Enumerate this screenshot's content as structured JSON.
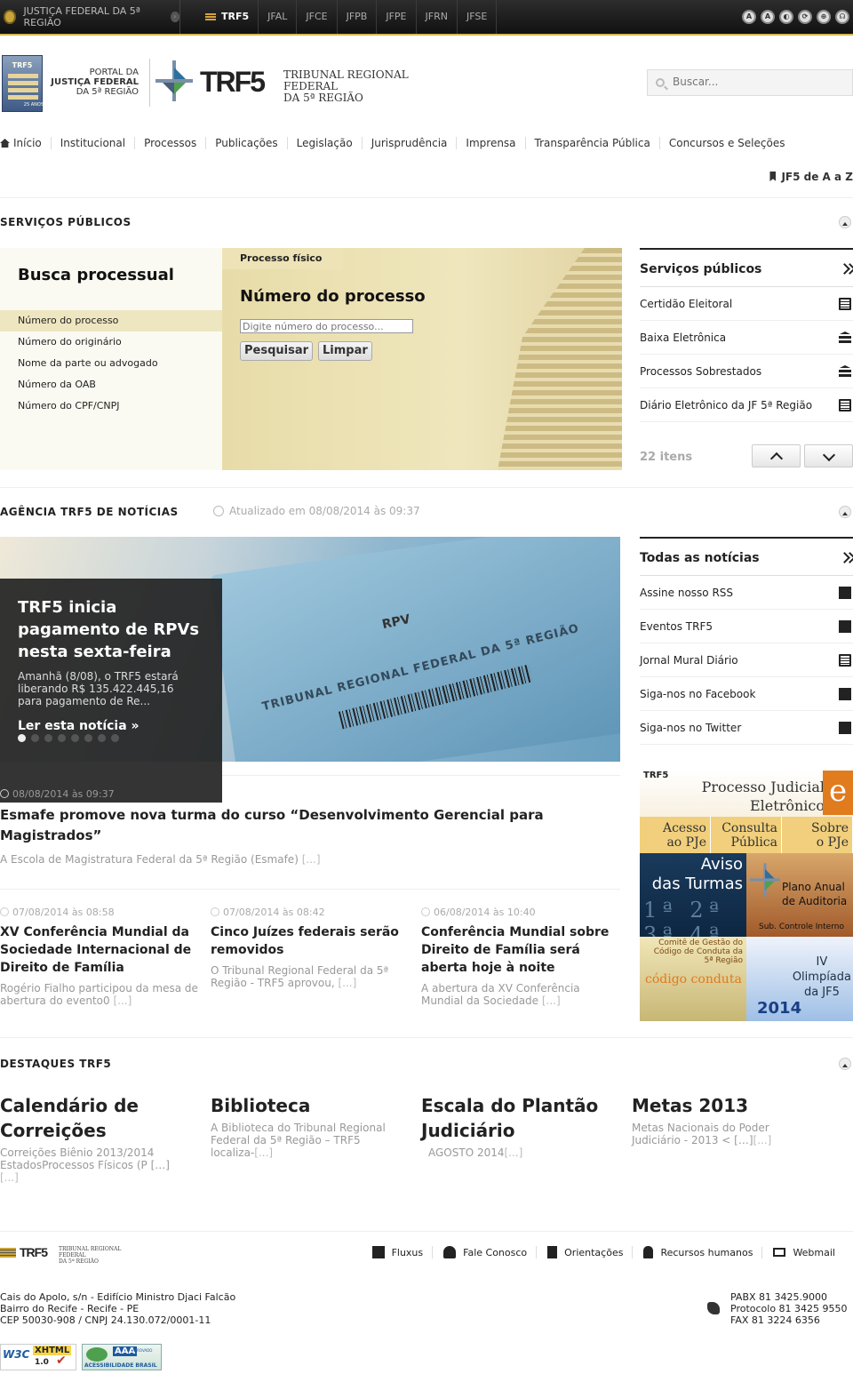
{
  "topbar": {
    "portal_link": "JUSTIÇA FEDERAL DA 5ª REGIÃO",
    "tabs": [
      "TRF5",
      "JFAL",
      "JFCE",
      "JFPB",
      "JFPE",
      "JFRN",
      "JFSE"
    ],
    "accessibility_icons": [
      "A",
      "A",
      "◐",
      "⟳",
      "⊕",
      "☊"
    ]
  },
  "header": {
    "portal_logo_small": "TRF5",
    "portal_logo_years": "25 ANOS",
    "portal_logo_line1": "PORTAL DA",
    "portal_logo_line2": "JUSTIÇA FEDERAL",
    "portal_logo_line3": "DA 5ª REGIÃO",
    "trf_logo": "TRF5",
    "trf_name_line1": "TRIBUNAL REGIONAL FEDERAL",
    "trf_name_line2": "DA 5ª REGIÃO",
    "search_placeholder": "Buscar..."
  },
  "nav": {
    "items": [
      "Início",
      "Institucional",
      "Processos",
      "Publicações",
      "Legislação",
      "Jurisprudência",
      "Imprensa",
      "Transparência Pública",
      "Concursos e Seleções"
    ],
    "jf5az": "JF5 de A a Z"
  },
  "servicos": {
    "section_title": "SERVIÇOS PÚBLICOS",
    "busca_title": "Busca processual",
    "options": [
      "Número do processo",
      "Número do originário",
      "Nome da parte ou advogado",
      "Número da OAB",
      "Número do CPF/CNPJ"
    ],
    "tab_label": "Processo físico",
    "form_title": "Número do processo",
    "input_placeholder": "Digite número do processo...",
    "search_button": "Pesquisar",
    "clear_button": "Limpar",
    "list_title": "Serviços públicos",
    "list": [
      "Certidão Eleitoral",
      "Baixa Eletrônica",
      "Processos Sobrestados",
      "Diário Eletrônico da JF 5ª Região"
    ],
    "count": "22 itens"
  },
  "noticias": {
    "section_title": "AGÊNCIA TRF5 DE NOTÍCIAS",
    "updated": "Atualizado em 08/08/2014 às 09:37",
    "hero": {
      "title": "TRF5 inicia pagamento de RPVs nesta sexta-feira",
      "summary": "Amanhã (8/08), o TRF5 estará liberando R$ 135.422.445,16 para pagamento de Re...",
      "read_more": "Ler esta notícia",
      "image_text_rpv": "RPV",
      "image_text_tribunal": "TRIBUNAL REGIONAL FEDERAL DA 5ª REGIÃO"
    },
    "slides": 8,
    "active_slide": 1,
    "featured": {
      "date": "08/08/2014 às 09:37",
      "title": "Esmafe promove nova turma do curso “Desenvolvimento Gerencial para Magistrados”",
      "summary": "A Escola de Magistratura Federal da 5ª Região (Esmafe)",
      "more": "[...]"
    },
    "items": [
      {
        "date": "07/08/2014 às 08:58",
        "title": "XV Conferência Mundial da Sociedade Internacional de Direito de Família",
        "summary": "Rogério Fialho participou da mesa de abertura do evento0",
        "more": "[...]"
      },
      {
        "date": "07/08/2014 às 08:42",
        "title": "Cinco Juízes federais serão removidos",
        "summary": "O Tribunal Regional Federal da 5ª Região - TRF5 aprovou,",
        "more": "[...]"
      },
      {
        "date": "06/08/2014 às 10:40",
        "title": "Conferência Mundial sobre Direito de Família será aberta hoje à noite",
        "summary": "A abertura da XV Conferência Mundial da Sociedade",
        "more": "[...]"
      }
    ],
    "list_title": "Todas as notícias",
    "list": [
      "Assine nosso RSS",
      "Eventos TRF5",
      "Jornal Mural Diário",
      "Siga-nos no Facebook",
      "Siga-nos no Twitter"
    ]
  },
  "banners": {
    "pje_small": "TRF5",
    "pje_title_line1": "Processo Judicial",
    "pje_title_line2": "Eletrônico",
    "pje_e": "e",
    "pje_cells": [
      [
        "Acesso",
        "ao PJe"
      ],
      [
        "Consulta",
        "Pública"
      ],
      [
        "Sobre",
        "o PJe"
      ]
    ],
    "aviso_line1": "Aviso",
    "aviso_line2": "das Turmas",
    "aviso_numbers": "1ª 2ª 3ª 4ª",
    "plano_line1": "Plano Anual",
    "plano_line2": "de Auditoria",
    "plano_sub": "Sub. Controle Interno",
    "codigo_text": "Comitê de Gestão do Código de Conduta da 5ª Região",
    "codigo_logo": "código conduta",
    "olimp_line1": "IV",
    "olimp_line2": "Olimpíada",
    "olimp_line3": "da JF5",
    "olimp_year": "2014"
  },
  "destaques": {
    "section_title": "DESTAQUES TRF5",
    "items": [
      {
        "title": "Calendário de Correições",
        "summary": "Correições Biênio 2013/2014 EstadosProcessos Físicos (P […]",
        "more": "[...]"
      },
      {
        "title": "Biblioteca",
        "summary": "A Biblioteca do Tribunal Regional Federal da 5ª Região – TRF5 localiza-",
        "more": "[...]"
      },
      {
        "title": "Escala do Plantão Judiciário",
        "summary": "AGOSTO 2014",
        "more": "[...]"
      },
      {
        "title": "Metas 2013",
        "summary": "Metas Nacionais do Poder Judiciário - 2013 < […]",
        "more": "[...]"
      }
    ]
  },
  "footer": {
    "logo": "TRF5",
    "logo_name_line1": "TRIBUNAL REGIONAL FEDERAL",
    "logo_name_line2": "DA 5ª REGIÃO",
    "links": [
      "Fluxus",
      "Fale Conosco",
      "Orientações",
      "Recursos humanos",
      "Webmail"
    ],
    "address": [
      "Cais do Apolo, s/n - Edifício Ministro Djaci Falcão",
      "Bairro do Recife - Recife - PE",
      "CEP 50030-908 / CNPJ 24.130.072/0001-11"
    ],
    "phones": [
      "PABX 81 3425.9000",
      "Protocolo 81 3425 9550",
      "FAX 81 3224 6356"
    ],
    "badge_w3c_top": "W3C",
    "badge_w3c_main": "XHTML",
    "badge_w3c_version": "1.0",
    "badge_aaa": "AAA",
    "badge_aaa_sub": "APROVADO",
    "badge_aaa_label": "ACESSIBILIDADE BRASIL"
  }
}
